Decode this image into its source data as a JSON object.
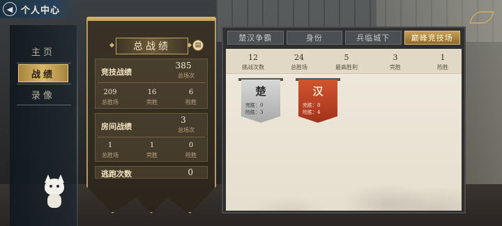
{
  "header": {
    "title": "个人中心",
    "back_icon": "back-icon"
  },
  "nav": {
    "items": [
      {
        "label": "主页"
      },
      {
        "label": "战绩"
      },
      {
        "label": "录像"
      }
    ],
    "active_index": 1
  },
  "summary_panel": {
    "title": "总战绩",
    "competitive": {
      "title": "竞技战绩",
      "total_value": "385",
      "total_label": "总场次",
      "cells": [
        {
          "value": "209",
          "label": "总胜场"
        },
        {
          "value": "16",
          "label": "完胜"
        },
        {
          "value": "6",
          "label": "险胜"
        }
      ]
    },
    "room": {
      "title": "房间战绩",
      "total_value": "3",
      "total_label": "总场次",
      "cells": [
        {
          "value": "1",
          "label": "总胜场"
        },
        {
          "value": "1",
          "label": "完胜"
        },
        {
          "value": "0",
          "label": "险胜"
        }
      ]
    },
    "escape": {
      "label": "逃跑次数",
      "value": "0"
    }
  },
  "tabs": [
    {
      "label": "楚汉争霸"
    },
    {
      "label": "身份"
    },
    {
      "label": "兵临城下"
    },
    {
      "label": "巅峰竞技场"
    }
  ],
  "active_tab": 3,
  "arena_summary": [
    {
      "value": "12",
      "label": "挑战次数"
    },
    {
      "value": "24",
      "label": "总胜场"
    },
    {
      "value": "5",
      "label": "最高胜利"
    },
    {
      "value": "3",
      "label": "完胜"
    },
    {
      "value": "1",
      "label": "险胜"
    }
  ],
  "factions": [
    {
      "name": "楚",
      "line1": "完胜：0",
      "line2": "险胜：3",
      "color": "#b5b5b5"
    },
    {
      "name": "汉",
      "line1": "完胜：8",
      "line2": "险胜：4",
      "color": "#b8412a"
    }
  ],
  "colors": {
    "accent_gold": "#c69f58",
    "nav_active": "#d9b767"
  }
}
